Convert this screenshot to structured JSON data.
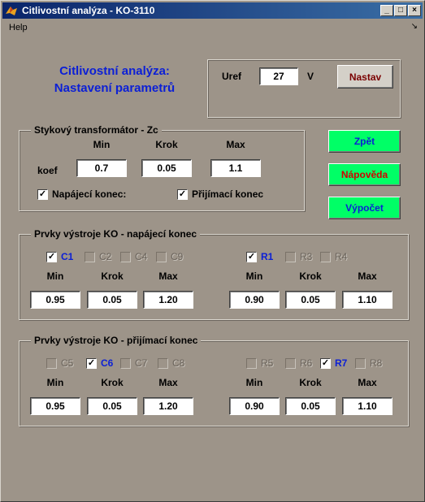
{
  "window": {
    "title": "Citlivostní analýza - KO-3110",
    "min_glyph": "_",
    "max_glyph": "□",
    "close_glyph": "×"
  },
  "menu": {
    "help": "Help",
    "arrow": "↘"
  },
  "heading": {
    "line1": "Citlivostní analýza:",
    "line2": "Nastavení parametrů"
  },
  "uref": {
    "label": "Uref",
    "value": "27",
    "unit": "V",
    "button": "Nastav"
  },
  "transformer": {
    "title": "Stykový transformátor - Zc",
    "row_label": "koef",
    "headers": {
      "min": "Min",
      "step": "Krok",
      "max": "Max"
    },
    "values": {
      "min": "0.7",
      "step": "0.05",
      "max": "1.1"
    },
    "feed_end": {
      "label": "Napájecí konec:",
      "checked": true
    },
    "receive_end": {
      "label": "Přijímací konec",
      "checked": true
    }
  },
  "buttons": {
    "back": "Zpět",
    "help": "Nápověda",
    "compute": "Výpočet",
    "colors": {
      "bg": "#00ff66",
      "back_text": "#0b1fd6",
      "help_text": "#d10000",
      "compute_text": "#0b1fd6"
    }
  },
  "feed_group": {
    "title": "Prvky výstroje KO - napájecí konec",
    "c_checks": [
      {
        "label": "C1",
        "checked": true,
        "enabled": true
      },
      {
        "label": "C2",
        "checked": false,
        "enabled": false
      },
      {
        "label": "C4",
        "checked": false,
        "enabled": false
      },
      {
        "label": "C9",
        "checked": false,
        "enabled": false
      }
    ],
    "r_checks": [
      {
        "label": "R1",
        "checked": true,
        "enabled": true
      },
      {
        "label": "R3",
        "checked": false,
        "enabled": false
      },
      {
        "label": "R4",
        "checked": false,
        "enabled": false
      }
    ],
    "headers": {
      "min": "Min",
      "step": "Krok",
      "max": "Max"
    },
    "c_values": {
      "min": "0.95",
      "step": "0.05",
      "max": "1.20"
    },
    "r_values": {
      "min": "0.90",
      "step": "0.05",
      "max": "1.10"
    }
  },
  "recv_group": {
    "title": "Prvky výstroje KO - přijímací konec",
    "c_checks": [
      {
        "label": "C5",
        "checked": false,
        "enabled": false
      },
      {
        "label": "C6",
        "checked": true,
        "enabled": true
      },
      {
        "label": "C7",
        "checked": false,
        "enabled": false
      },
      {
        "label": "C8",
        "checked": false,
        "enabled": false
      }
    ],
    "r_checks": [
      {
        "label": "R5",
        "checked": false,
        "enabled": false
      },
      {
        "label": "R6",
        "checked": false,
        "enabled": false
      },
      {
        "label": "R7",
        "checked": true,
        "enabled": true
      },
      {
        "label": "R8",
        "checked": false,
        "enabled": false
      }
    ],
    "headers": {
      "min": "Min",
      "step": "Krok",
      "max": "Max"
    },
    "c_values": {
      "min": "0.95",
      "step": "0.05",
      "max": "1.20"
    },
    "r_values": {
      "min": "0.90",
      "step": "0.05",
      "max": "1.10"
    }
  },
  "check_glyph": "✓"
}
